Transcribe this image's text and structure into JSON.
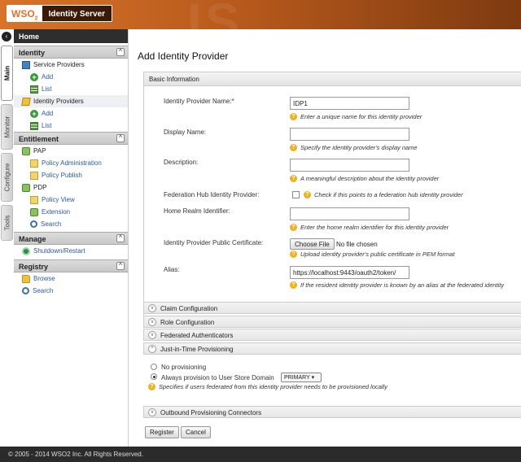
{
  "header": {
    "brand": "WSO",
    "brand_sub": "2",
    "product": "Identity Server"
  },
  "vtabs": {
    "main": "Main",
    "monitor": "Monitor",
    "configure": "Configure",
    "tools": "Tools"
  },
  "nav": {
    "home": "Home",
    "identity": {
      "title": "Identity",
      "service_providers": "Service Providers",
      "sp_add": "Add",
      "sp_list": "List",
      "identity_providers": "Identity Providers",
      "idp_add": "Add",
      "idp_list": "List"
    },
    "entitlement": {
      "title": "Entitlement",
      "pap": "PAP",
      "policy_admin": "Policy Administration",
      "policy_publish": "Policy Publish",
      "pdp": "PDP",
      "policy_view": "Policy View",
      "extension": "Extension",
      "search": "Search"
    },
    "manage": {
      "title": "Manage",
      "shutdown": "Shutdown/Restart"
    },
    "registry": {
      "title": "Registry",
      "browse": "Browse",
      "search": "Search"
    }
  },
  "main": {
    "title": "Add Identity Provider",
    "basic_info": "Basic Information",
    "name_label": "Identity Provider Name:",
    "name_value": "IDP1",
    "name_help": "Enter a unique name for this identity provider",
    "display_label": "Display Name:",
    "display_help": "Specify the identity provider's display name",
    "desc_label": "Description:",
    "desc_help": "A meaningful description about the identity provider",
    "fedhub_label": "Federation Hub Identity Provider:",
    "fedhub_help": "Check if this points to a federation hub identity provider",
    "realm_label": "Home Realm Identifier:",
    "realm_help": "Enter the home realm identifier for this identity provider",
    "cert_label": "Identity Provider Public Certificate:",
    "choose_file": "Choose File",
    "no_file": "No file chosen",
    "cert_help": "Upload identity provider's public certificate in PEM format",
    "alias_label": "Alias:",
    "alias_value": "https://localhost:9443/oauth2/token/",
    "alias_help": "If the resident identity provider is known by an alias at the federated identity",
    "claim_config": "Claim Configuration",
    "role_config": "Role Configuration",
    "fed_auth": "Federated Authenticators",
    "jit": "Just-in-Time Provisioning",
    "no_prov": "No provisioning",
    "always_prov": "Always provision to User Store Domain",
    "domain": "PRIMARY",
    "jit_help": "Specifies if users federated from this identity provider needs to be provisioned locally",
    "outbound": "Outbound Provisioning Connectors",
    "register": "Register",
    "cancel": "Cancel"
  },
  "footer": {
    "copyright": "© 2005 - 2014 WSO2 Inc. All Rights Reserved."
  }
}
